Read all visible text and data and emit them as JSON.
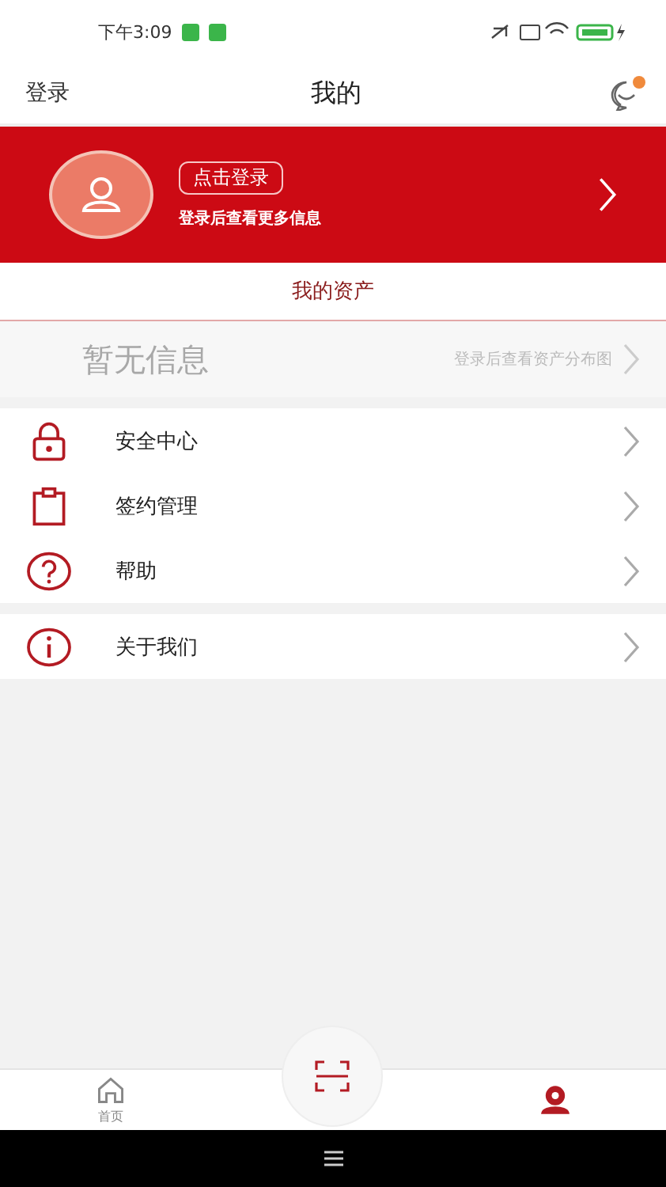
{
  "status_bar": {
    "time": "下午3:09"
  },
  "header": {
    "left": "登录",
    "title": "我的",
    "has_notice": true
  },
  "login_card": {
    "button": "点击登录",
    "subtitle": "登录后查看更多信息"
  },
  "assets": {
    "title": "我的资产",
    "empty": "暂无信息",
    "link": "登录后查看资产分布图"
  },
  "menu_groups": [
    [
      {
        "label": "安全中心",
        "kind": "lock"
      },
      {
        "label": "签约管理",
        "kind": "clipboard"
      },
      {
        "label": "帮助",
        "kind": "help"
      }
    ],
    [
      {
        "label": "关于我们",
        "kind": "info"
      }
    ]
  ],
  "bottom_nav": [
    {
      "label": "首页",
      "kind": "home",
      "selected": false
    },
    {
      "kind": "user",
      "selected": true
    }
  ]
}
